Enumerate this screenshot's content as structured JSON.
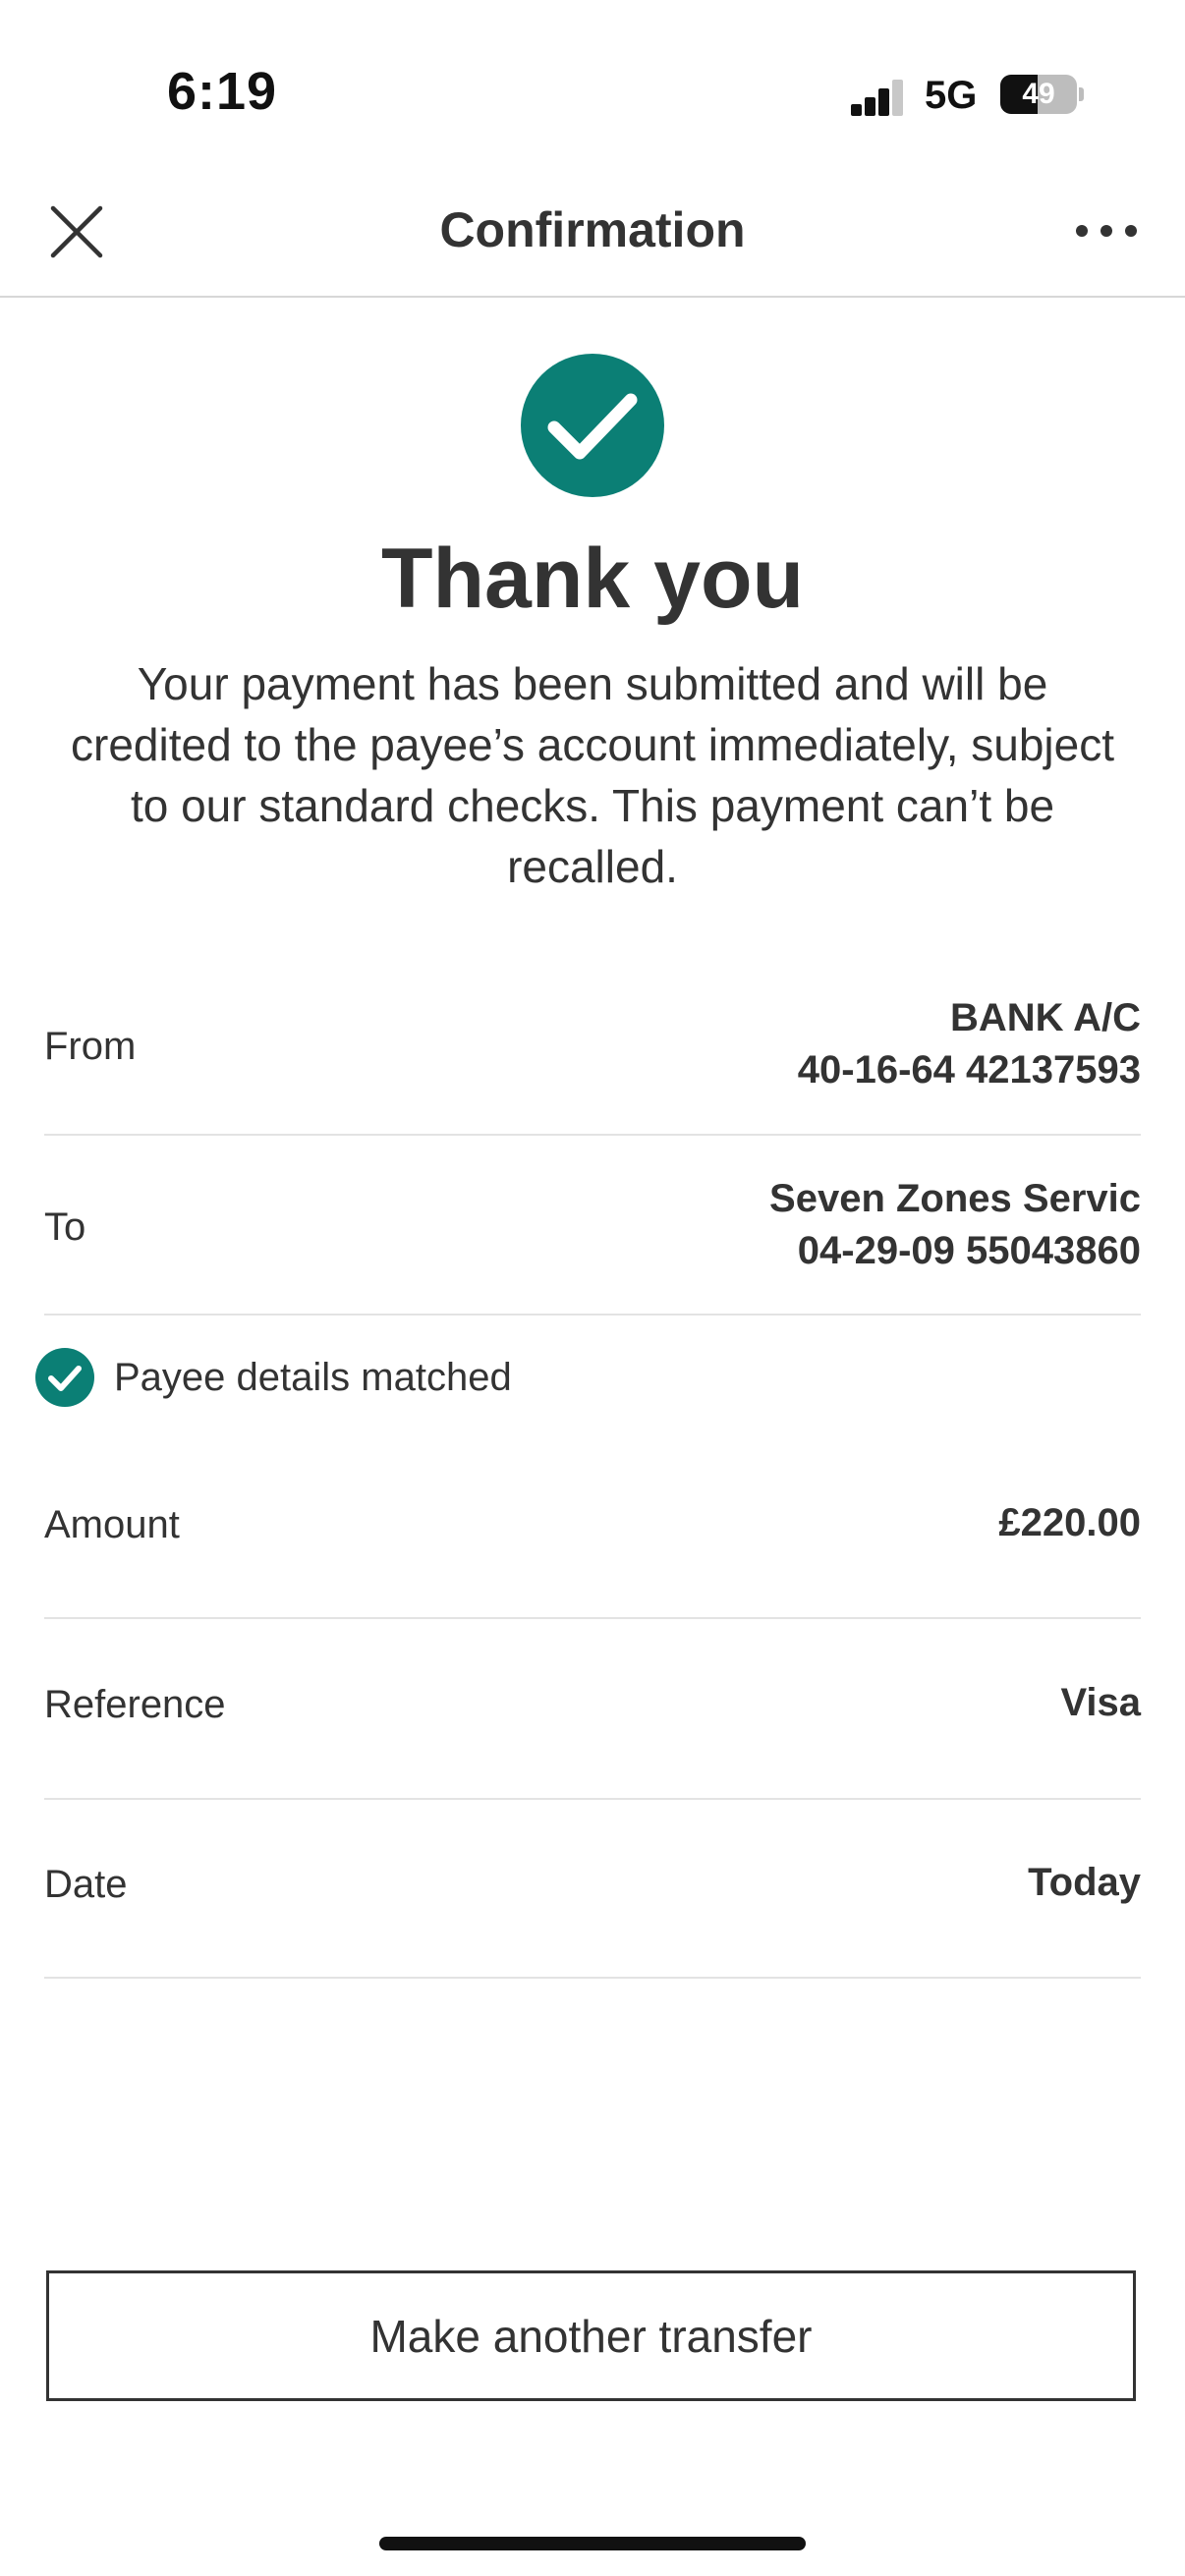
{
  "status_bar": {
    "time": "6:19",
    "network": "5G",
    "battery_level": 49,
    "battery_text": "49"
  },
  "header": {
    "title": "Confirmation",
    "close_icon": "close-icon",
    "more_icon": "more-horizontal-icon"
  },
  "success": {
    "icon": "check-circle-icon",
    "heading": "Thank you",
    "message": "Your payment has been submitted and will be credited to the payee’s account immediately, subject to our standard checks. This payment can’t be recalled."
  },
  "details": {
    "from": {
      "label": "From",
      "account_name": "BANK A/C",
      "account_number": "40-16-64 42137593"
    },
    "to": {
      "label": "To",
      "account_name": "Seven Zones Servic",
      "account_number": "04-29-09 55043860"
    },
    "payee_match": {
      "icon": "check-circle-icon",
      "text": "Payee details matched"
    },
    "amount": {
      "label": "Amount",
      "value": "£220.00"
    },
    "reference": {
      "label": "Reference",
      "value": "Visa"
    },
    "date": {
      "label": "Date",
      "value": "Today"
    }
  },
  "actions": {
    "make_another_transfer": "Make another transfer"
  },
  "colors": {
    "accent": "#0b7f75",
    "text": "#333333",
    "divider": "#e3e3e3"
  }
}
